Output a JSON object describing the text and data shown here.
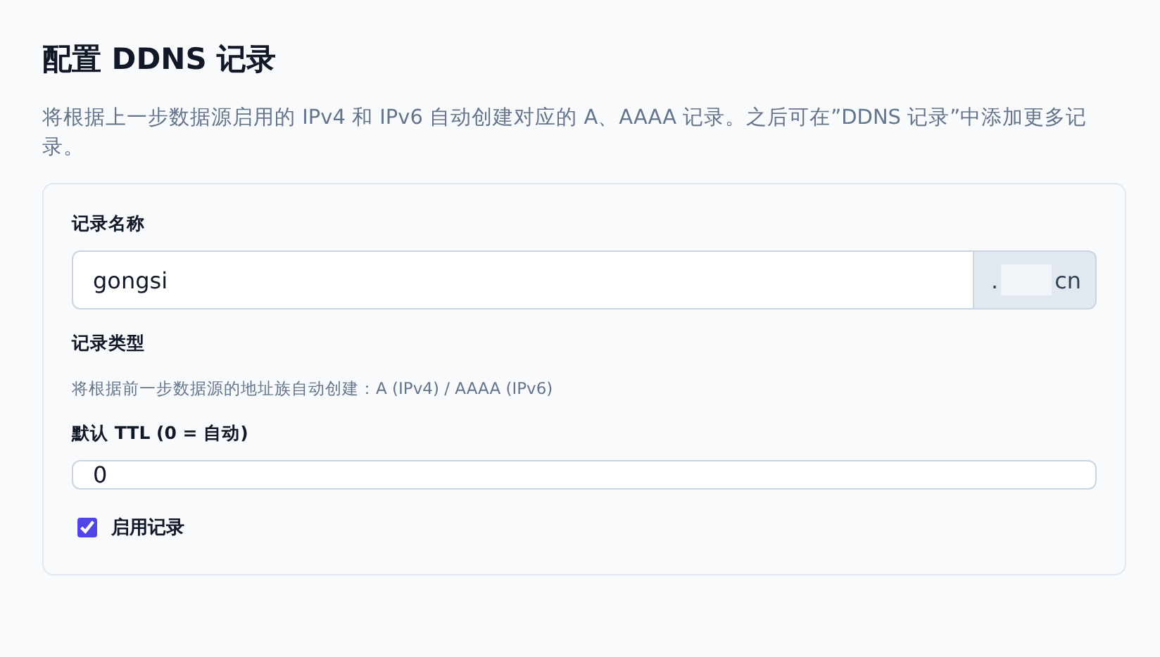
{
  "title": "配置 DDNS 记录",
  "description": "将根据上一步数据源启用的 IPv4 和 IPv6 自动创建对应的 A、AAAA 记录。之后可在”DDNS 记录”中添加更多记录。",
  "form": {
    "record_name": {
      "label": "记录名称",
      "value": "gongsi",
      "suffix_start": ".",
      "suffix_end": "cn"
    },
    "record_type": {
      "label": "记录类型",
      "hint": "将根据前一步数据源的地址族自动创建：A (IPv4) / AAAA (IPv6)"
    },
    "ttl": {
      "label": "默认 TTL (0 = 自动)",
      "value": "0"
    },
    "enable": {
      "label": "启用记录",
      "checked": true
    }
  }
}
